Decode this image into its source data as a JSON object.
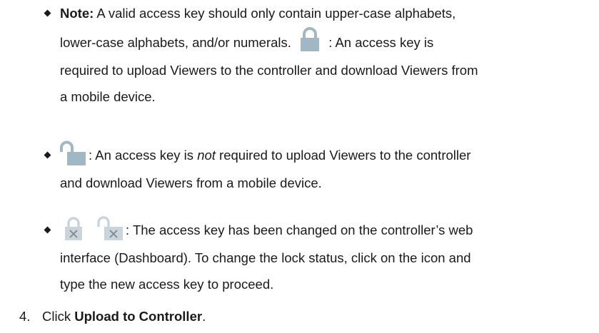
{
  "bullets": [
    {
      "note_label": "Note:",
      "line1": "A valid access key should only contain upper-case alphabets,",
      "line2_pre": "lower-case alphabets, and/or numerals.",
      "line2_post": ": An access key is",
      "line3": "required to upload Viewers to the controller and download Viewers from",
      "line4": "a mobile device."
    },
    {
      "line1_pre": ": An access key is",
      "line1_em": "not",
      "line1_post": "required to upload Viewers to the controller",
      "line2": "and download Viewers from a mobile device."
    },
    {
      "line1": ": The access key has been changed on the controller’s web",
      "line2": "interface (Dashboard). To change the lock status, click on the icon and",
      "line3": "type the new access key to proceed."
    }
  ],
  "step": {
    "number": "4.",
    "text_pre": "Click",
    "text_bold": "Upload to Controller",
    "text_post": "."
  },
  "icons": {
    "locked": "lock-closed-icon",
    "unlocked": "lock-open-icon",
    "locked_changed": "lock-closed-x-icon",
    "unlocked_changed": "lock-open-x-icon",
    "lock_color": "#9fb8c3",
    "changed_color": "#c9d5db",
    "x_color": "#8a8f93"
  }
}
